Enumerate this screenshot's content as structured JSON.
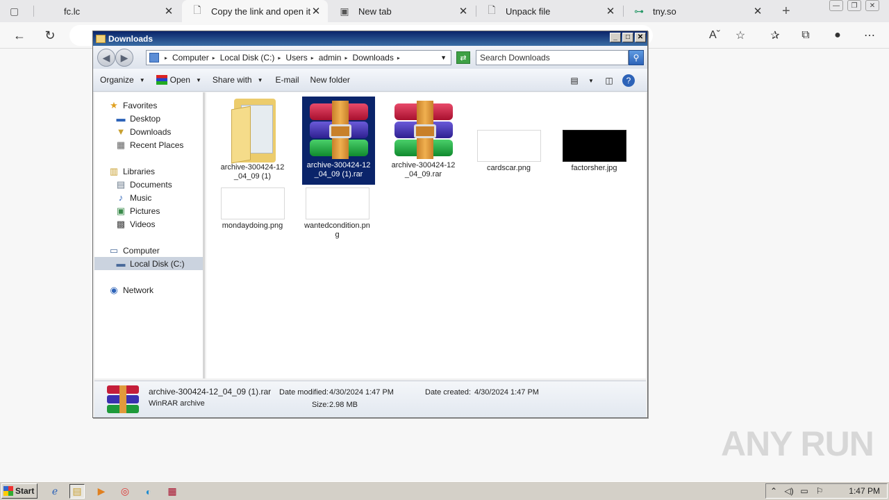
{
  "browser": {
    "tabs": [
      {
        "label": "fc.lc",
        "icon": "page-icon",
        "active": false
      },
      {
        "label": "Copy the link and open it in",
        "icon": "page-icon",
        "active": true
      },
      {
        "label": "New tab",
        "icon": "newtab-icon",
        "active": false
      },
      {
        "label": "Unpack file",
        "icon": "page-icon",
        "active": false
      },
      {
        "label": "tny.so",
        "icon": "link-icon",
        "active": false
      }
    ]
  },
  "explorer": {
    "title": "Downloads",
    "breadcrumbs": [
      "Computer",
      "Local Disk (C:)",
      "Users",
      "admin",
      "Downloads"
    ],
    "search_placeholder": "Search Downloads",
    "toolbar": {
      "organize": "Organize",
      "open": "Open",
      "share_with": "Share with",
      "email": "E-mail",
      "new_folder": "New folder"
    },
    "nav": {
      "favorites": "Favorites",
      "desktop": "Desktop",
      "downloads": "Downloads",
      "recent_places": "Recent Places",
      "libraries": "Libraries",
      "documents": "Documents",
      "music": "Music",
      "pictures": "Pictures",
      "videos": "Videos",
      "computer": "Computer",
      "local_disk": "Local Disk (C:)",
      "network": "Network"
    },
    "files": [
      {
        "name_line1": "archive-300424-12",
        "name_line2": "_04_09 (1)",
        "type": "folder"
      },
      {
        "name_line1": "archive-300424-12",
        "name_line2": "_04_09 (1).rar",
        "type": "rar",
        "selected": true
      },
      {
        "name_line1": "archive-300424-12",
        "name_line2": "_04_09.rar",
        "type": "rar"
      },
      {
        "name_line1": "cardscar.png",
        "name_line2": "",
        "type": "png"
      },
      {
        "name_line1": "factorsher.jpg",
        "name_line2": "",
        "type": "jpg"
      },
      {
        "name_line1": "mondaydoing.png",
        "name_line2": "",
        "type": "png"
      },
      {
        "name_line1": "wantedcondition.pn",
        "name_line2": "g",
        "type": "png"
      }
    ],
    "details": {
      "filename": "archive-300424-12_04_09 (1).rar",
      "filetype": "WinRAR archive",
      "modified_label": "Date modified:",
      "modified_value": "4/30/2024 1:47 PM",
      "created_label": "Date created:",
      "created_value": "4/30/2024 1:47 PM",
      "size_label": "Size:",
      "size_value": "2.98 MB"
    }
  },
  "taskbar": {
    "start": "Start",
    "clock": "1:47 PM"
  },
  "watermark": "ANY RUN"
}
